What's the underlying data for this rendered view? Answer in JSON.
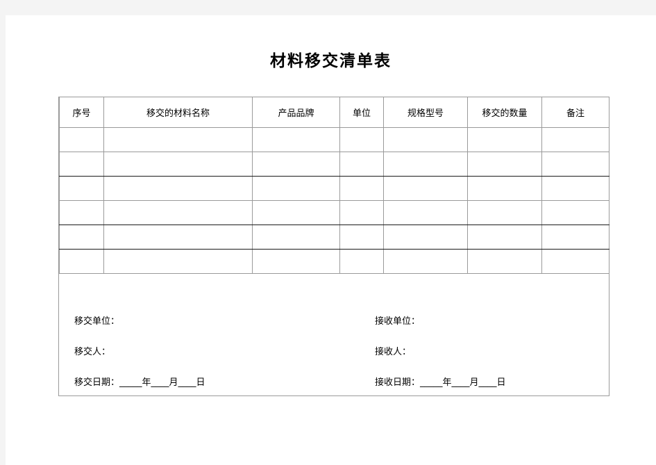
{
  "document": {
    "title": "材料移交清单表",
    "background_color": "#f4f4f4",
    "page_color": "#ffffff",
    "border_color": "#9a9a9a",
    "grid_line_color": "#1a1a1a"
  },
  "table": {
    "headers": [
      "序号",
      "移交的材料名称",
      "产品品牌",
      "单位",
      "规格型号",
      "移交的数量",
      "备注"
    ],
    "rows": [
      [
        "",
        "",
        "",
        "",
        "",
        "",
        ""
      ],
      [
        "",
        "",
        "",
        "",
        "",
        "",
        ""
      ],
      [
        "",
        "",
        "",
        "",
        "",
        "",
        ""
      ],
      [
        "",
        "",
        "",
        "",
        "",
        "",
        ""
      ],
      [
        "",
        "",
        "",
        "",
        "",
        "",
        ""
      ],
      [
        "",
        "",
        "",
        "",
        "",
        "",
        ""
      ]
    ],
    "row_count": 6,
    "column_count": 7
  },
  "signature": {
    "left": {
      "unit_label": "移交单位：",
      "person_label": "移交人：",
      "date_label": "移交日期：_____年____月____日"
    },
    "right": {
      "unit_label": "接收单位：",
      "person_label": "接收人：",
      "date_label": "接收日期：_____年____月____日"
    }
  }
}
